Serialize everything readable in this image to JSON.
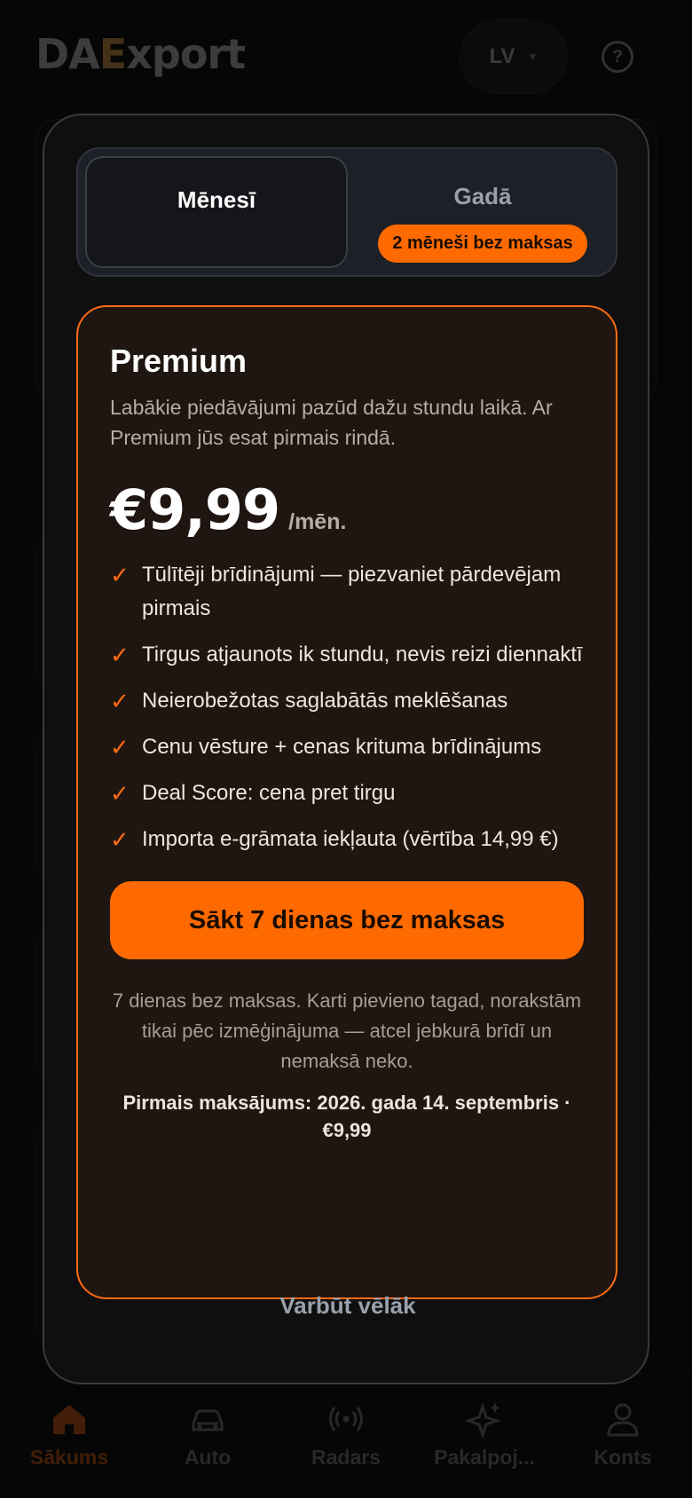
{
  "header": {
    "logo": "DAEXport",
    "language": "LV"
  },
  "bottom_nav": [
    {
      "label": "Sākums",
      "icon": "home-icon",
      "active": true
    },
    {
      "label": "Auto",
      "icon": "car-icon",
      "active": false
    },
    {
      "label": "Radars",
      "icon": "radar-icon",
      "active": false
    },
    {
      "label": "Pakalpoj...",
      "icon": "sparkle-icon",
      "active": false
    },
    {
      "label": "Konts",
      "icon": "user-icon",
      "active": false
    }
  ],
  "modal": {
    "toggle": {
      "month_label": "Mēnesī",
      "year_label": "Gadā",
      "year_badge": "2 mēneši bez maksas",
      "selected": "month"
    },
    "plan": {
      "title": "Premium",
      "description": "Labākie piedāvājumi pazūd dažu stundu laikā. Ar Premium jūs esat pirmais rindā.",
      "price": "€9,99",
      "period": "/mēn.",
      "check_symbol": "✓",
      "features": [
        "Tūlītēji brīdinājumi — piezvaniet pārdevējam pirmais",
        "Tirgus atjaunots ik stundu, nevis reizi diennaktī",
        "Neierobežotas saglabātās meklēšanas",
        "Cenu vēsture + cenas krituma brīdinājums",
        "Deal Score: cena pret tirgu",
        "Importa e-grāmata iekļauta (vērtība 14,99 €)"
      ],
      "cta_label": "Sākt 7 dienas bez maksas",
      "trial_note": "7 dienas bez maksas. Karti pievieno tagad, norakstām tikai pēc izmēģinājuma — atcel jebkurā brīdī un nemaksā neko.",
      "first_payment": "Pirmais maksājums: 2026. gada 14. septembris · €9,99"
    },
    "later_label": "Varbūt vēlāk"
  },
  "colors": {
    "accent": "#ff6a00",
    "plan_background": "#1f1611",
    "modal_background": "#0f0f10"
  }
}
